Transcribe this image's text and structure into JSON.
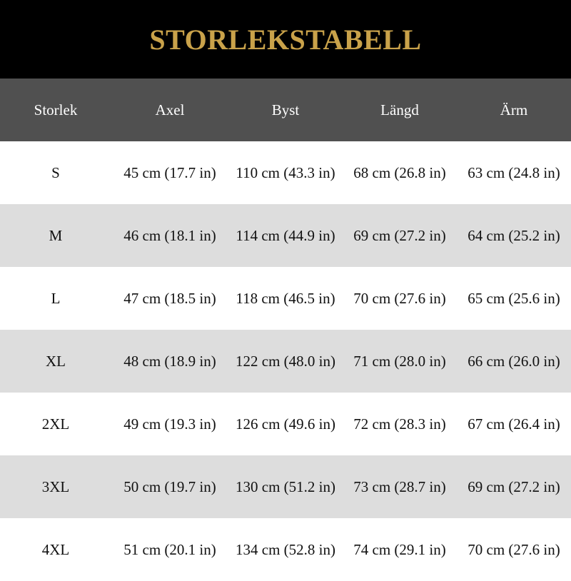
{
  "title": "STORLEKSTABELL",
  "colors": {
    "title_bar": "#000000",
    "title_text": "#c9a24a",
    "header_bg": "#505050",
    "row_alt_bg": "#dddddd"
  },
  "table": {
    "headers": [
      "Storlek",
      "Axel",
      "Byst",
      "Längd",
      "Ärm"
    ],
    "rows": [
      [
        "S",
        "45 cm (17.7 in)",
        "110 cm (43.3 in)",
        "68 cm (26.8 in)",
        "63 cm (24.8 in)"
      ],
      [
        "M",
        "46 cm (18.1 in)",
        "114 cm (44.9 in)",
        "69 cm (27.2 in)",
        "64 cm (25.2 in)"
      ],
      [
        "L",
        "47 cm (18.5 in)",
        "118 cm (46.5 in)",
        "70 cm (27.6 in)",
        "65 cm (25.6 in)"
      ],
      [
        "XL",
        "48 cm (18.9 in)",
        "122 cm (48.0 in)",
        "71 cm (28.0 in)",
        "66 cm (26.0 in)"
      ],
      [
        "2XL",
        "49 cm (19.3 in)",
        "126 cm (49.6 in)",
        "72 cm (28.3 in)",
        "67 cm (26.4 in)"
      ],
      [
        "3XL",
        "50 cm (19.7 in)",
        "130 cm (51.2 in)",
        "73 cm (28.7 in)",
        "69 cm (27.2 in)"
      ],
      [
        "4XL",
        "51 cm (20.1 in)",
        "134 cm (52.8 in)",
        "74 cm (29.1 in)",
        "70 cm (27.6 in)"
      ]
    ]
  }
}
